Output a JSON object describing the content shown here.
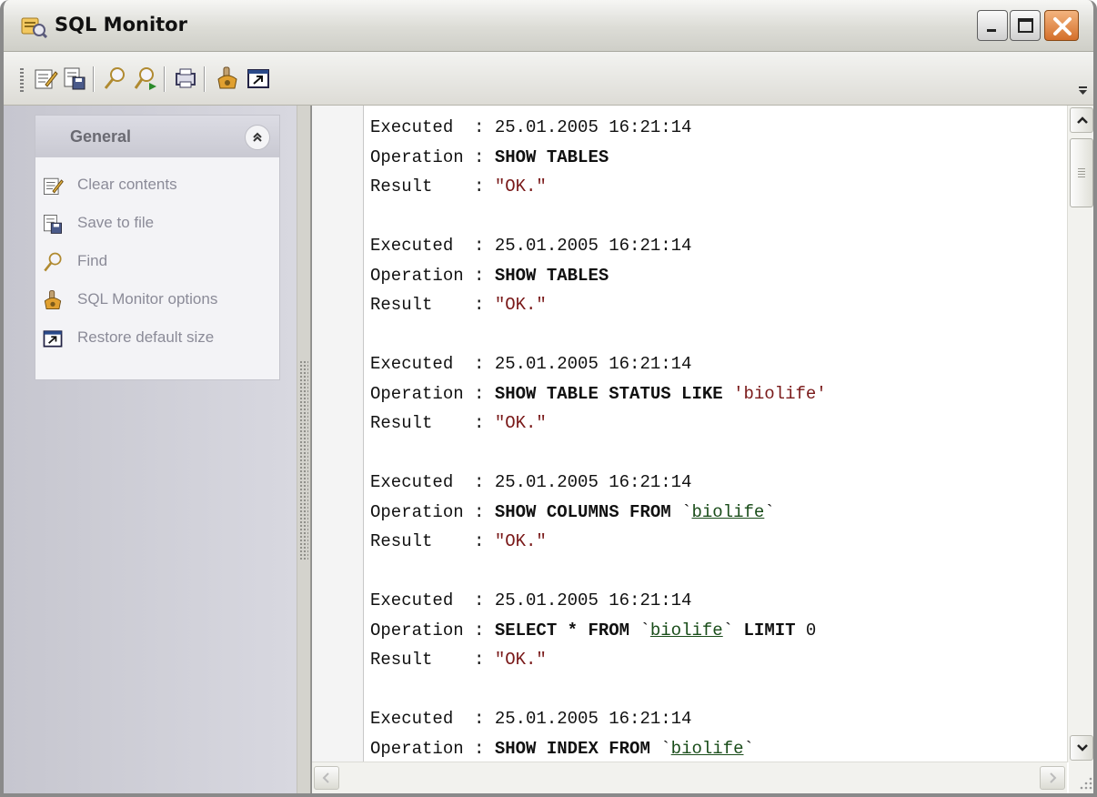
{
  "window": {
    "title": "SQL Monitor",
    "controls": [
      "minimize",
      "maximize",
      "close"
    ]
  },
  "toolbar": {
    "buttons": [
      {
        "name": "clear-contents-icon"
      },
      {
        "name": "save-to-file-icon"
      },
      {
        "name": "find-icon"
      },
      {
        "name": "find-next-icon"
      },
      {
        "name": "print-icon"
      },
      {
        "name": "sql-monitor-options-icon"
      },
      {
        "name": "restore-default-size-icon"
      }
    ]
  },
  "sidebar": {
    "panel_title": "General",
    "items": [
      {
        "label": "Clear contents",
        "icon": "clear-contents-icon"
      },
      {
        "label": "Save to file",
        "icon": "save-to-file-icon"
      },
      {
        "label": "Find",
        "icon": "find-icon"
      },
      {
        "label": "SQL Monitor options",
        "icon": "sql-monitor-options-icon"
      },
      {
        "label": "Restore default size",
        "icon": "restore-default-size-icon"
      }
    ]
  },
  "log": {
    "executed_label": "Executed  : ",
    "operation_label": "Operation : ",
    "result_label": "Result    : ",
    "entries": [
      {
        "executed": "25.01.2005 16:21:14",
        "operation": [
          {
            "t": "SHOW TABLES",
            "s": "kw"
          }
        ],
        "result": "\"OK.\""
      },
      {
        "executed": "25.01.2005 16:21:14",
        "operation": [
          {
            "t": "SHOW TABLES",
            "s": "kw"
          }
        ],
        "result": "\"OK.\""
      },
      {
        "executed": "25.01.2005 16:21:14",
        "operation": [
          {
            "t": "SHOW TABLE STATUS LIKE",
            "s": "kw"
          },
          {
            "t": " ",
            "s": ""
          },
          {
            "t": "'biolife'",
            "s": "str"
          }
        ],
        "result": "\"OK.\""
      },
      {
        "executed": "25.01.2005 16:21:14",
        "operation": [
          {
            "t": "SHOW COLUMNS FROM",
            "s": "kw"
          },
          {
            "t": " `",
            "s": ""
          },
          {
            "t": "biolife",
            "s": "ul"
          },
          {
            "t": "`",
            "s": ""
          }
        ],
        "result": "\"OK.\""
      },
      {
        "executed": "25.01.2005 16:21:14",
        "operation": [
          {
            "t": "SELECT * FROM",
            "s": "kw"
          },
          {
            "t": " `",
            "s": ""
          },
          {
            "t": "biolife",
            "s": "ul"
          },
          {
            "t": "` ",
            "s": ""
          },
          {
            "t": "LIMIT",
            "s": "kw"
          },
          {
            "t": " 0",
            "s": ""
          }
        ],
        "result": "\"OK.\""
      },
      {
        "executed": "25.01.2005 16:21:14",
        "operation": [
          {
            "t": "SHOW INDEX FROM",
            "s": "kw"
          },
          {
            "t": " `",
            "s": ""
          },
          {
            "t": "biolife",
            "s": "ul"
          },
          {
            "t": "`",
            "s": ""
          }
        ],
        "result": null
      }
    ]
  }
}
